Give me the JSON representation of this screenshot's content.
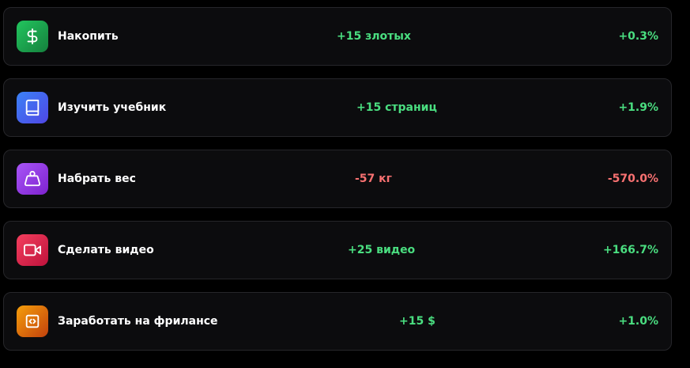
{
  "goals": [
    {
      "icon": "dollar-icon",
      "title": "Накопить",
      "delta": "+15 злотых",
      "percent": "+0.3%",
      "trend": "positive",
      "icon_gradient": [
        "#22c55e",
        "#15803d"
      ]
    },
    {
      "icon": "book-icon",
      "title": "Изучить учебник",
      "delta": "+15 страниц",
      "percent": "+1.9%",
      "trend": "positive",
      "icon_gradient": [
        "#3b82f6",
        "#4f46e5"
      ]
    },
    {
      "icon": "weight-icon",
      "title": "Набрать вес",
      "delta": "-57 кг",
      "percent": "-570.0%",
      "trend": "negative",
      "icon_gradient": [
        "#a855f7",
        "#7e22ce"
      ]
    },
    {
      "icon": "video-camera-icon",
      "title": "Сделать видео",
      "delta": "+25 видео",
      "percent": "+166.7%",
      "trend": "positive",
      "icon_gradient": [
        "#f43f5e",
        "#be123c"
      ]
    },
    {
      "icon": "code-icon",
      "title": "Заработать на фрилансе",
      "delta": "+15 $",
      "percent": "+1.0%",
      "trend": "positive",
      "icon_gradient": [
        "#f59e0b",
        "#c2410c"
      ]
    }
  ],
  "colors": {
    "positive": "#4ade80",
    "negative": "#f87171",
    "card_background": "#0c0c0e",
    "card_border": "#26262a",
    "page_background": "#000000"
  }
}
